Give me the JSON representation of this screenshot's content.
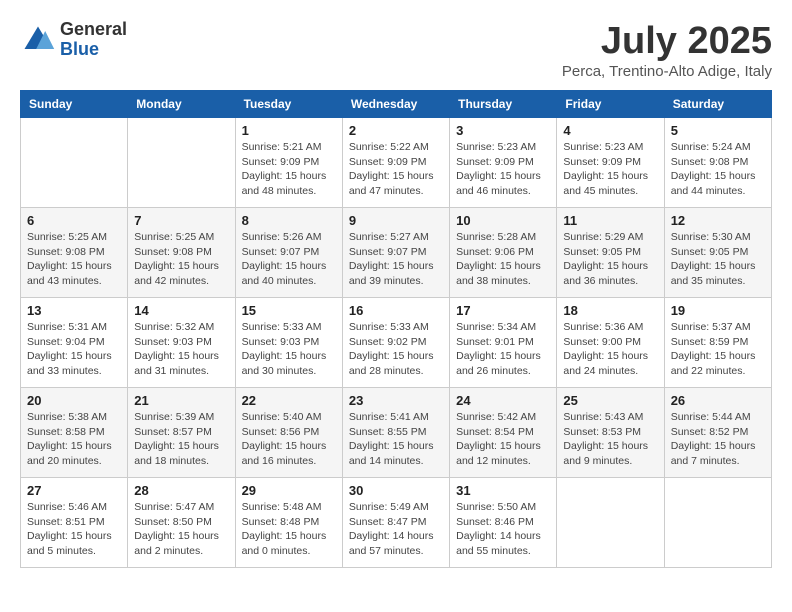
{
  "header": {
    "logo_line1": "General",
    "logo_line2": "Blue",
    "month": "July 2025",
    "location": "Perca, Trentino-Alto Adige, Italy"
  },
  "weekdays": [
    "Sunday",
    "Monday",
    "Tuesday",
    "Wednesday",
    "Thursday",
    "Friday",
    "Saturday"
  ],
  "weeks": [
    [
      {
        "day": "",
        "info": ""
      },
      {
        "day": "",
        "info": ""
      },
      {
        "day": "1",
        "info": "Sunrise: 5:21 AM\nSunset: 9:09 PM\nDaylight: 15 hours\nand 48 minutes."
      },
      {
        "day": "2",
        "info": "Sunrise: 5:22 AM\nSunset: 9:09 PM\nDaylight: 15 hours\nand 47 minutes."
      },
      {
        "day": "3",
        "info": "Sunrise: 5:23 AM\nSunset: 9:09 PM\nDaylight: 15 hours\nand 46 minutes."
      },
      {
        "day": "4",
        "info": "Sunrise: 5:23 AM\nSunset: 9:09 PM\nDaylight: 15 hours\nand 45 minutes."
      },
      {
        "day": "5",
        "info": "Sunrise: 5:24 AM\nSunset: 9:08 PM\nDaylight: 15 hours\nand 44 minutes."
      }
    ],
    [
      {
        "day": "6",
        "info": "Sunrise: 5:25 AM\nSunset: 9:08 PM\nDaylight: 15 hours\nand 43 minutes."
      },
      {
        "day": "7",
        "info": "Sunrise: 5:25 AM\nSunset: 9:08 PM\nDaylight: 15 hours\nand 42 minutes."
      },
      {
        "day": "8",
        "info": "Sunrise: 5:26 AM\nSunset: 9:07 PM\nDaylight: 15 hours\nand 40 minutes."
      },
      {
        "day": "9",
        "info": "Sunrise: 5:27 AM\nSunset: 9:07 PM\nDaylight: 15 hours\nand 39 minutes."
      },
      {
        "day": "10",
        "info": "Sunrise: 5:28 AM\nSunset: 9:06 PM\nDaylight: 15 hours\nand 38 minutes."
      },
      {
        "day": "11",
        "info": "Sunrise: 5:29 AM\nSunset: 9:05 PM\nDaylight: 15 hours\nand 36 minutes."
      },
      {
        "day": "12",
        "info": "Sunrise: 5:30 AM\nSunset: 9:05 PM\nDaylight: 15 hours\nand 35 minutes."
      }
    ],
    [
      {
        "day": "13",
        "info": "Sunrise: 5:31 AM\nSunset: 9:04 PM\nDaylight: 15 hours\nand 33 minutes."
      },
      {
        "day": "14",
        "info": "Sunrise: 5:32 AM\nSunset: 9:03 PM\nDaylight: 15 hours\nand 31 minutes."
      },
      {
        "day": "15",
        "info": "Sunrise: 5:33 AM\nSunset: 9:03 PM\nDaylight: 15 hours\nand 30 minutes."
      },
      {
        "day": "16",
        "info": "Sunrise: 5:33 AM\nSunset: 9:02 PM\nDaylight: 15 hours\nand 28 minutes."
      },
      {
        "day": "17",
        "info": "Sunrise: 5:34 AM\nSunset: 9:01 PM\nDaylight: 15 hours\nand 26 minutes."
      },
      {
        "day": "18",
        "info": "Sunrise: 5:36 AM\nSunset: 9:00 PM\nDaylight: 15 hours\nand 24 minutes."
      },
      {
        "day": "19",
        "info": "Sunrise: 5:37 AM\nSunset: 8:59 PM\nDaylight: 15 hours\nand 22 minutes."
      }
    ],
    [
      {
        "day": "20",
        "info": "Sunrise: 5:38 AM\nSunset: 8:58 PM\nDaylight: 15 hours\nand 20 minutes."
      },
      {
        "day": "21",
        "info": "Sunrise: 5:39 AM\nSunset: 8:57 PM\nDaylight: 15 hours\nand 18 minutes."
      },
      {
        "day": "22",
        "info": "Sunrise: 5:40 AM\nSunset: 8:56 PM\nDaylight: 15 hours\nand 16 minutes."
      },
      {
        "day": "23",
        "info": "Sunrise: 5:41 AM\nSunset: 8:55 PM\nDaylight: 15 hours\nand 14 minutes."
      },
      {
        "day": "24",
        "info": "Sunrise: 5:42 AM\nSunset: 8:54 PM\nDaylight: 15 hours\nand 12 minutes."
      },
      {
        "day": "25",
        "info": "Sunrise: 5:43 AM\nSunset: 8:53 PM\nDaylight: 15 hours\nand 9 minutes."
      },
      {
        "day": "26",
        "info": "Sunrise: 5:44 AM\nSunset: 8:52 PM\nDaylight: 15 hours\nand 7 minutes."
      }
    ],
    [
      {
        "day": "27",
        "info": "Sunrise: 5:46 AM\nSunset: 8:51 PM\nDaylight: 15 hours\nand 5 minutes."
      },
      {
        "day": "28",
        "info": "Sunrise: 5:47 AM\nSunset: 8:50 PM\nDaylight: 15 hours\nand 2 minutes."
      },
      {
        "day": "29",
        "info": "Sunrise: 5:48 AM\nSunset: 8:48 PM\nDaylight: 15 hours\nand 0 minutes."
      },
      {
        "day": "30",
        "info": "Sunrise: 5:49 AM\nSunset: 8:47 PM\nDaylight: 14 hours\nand 57 minutes."
      },
      {
        "day": "31",
        "info": "Sunrise: 5:50 AM\nSunset: 8:46 PM\nDaylight: 14 hours\nand 55 minutes."
      },
      {
        "day": "",
        "info": ""
      },
      {
        "day": "",
        "info": ""
      }
    ]
  ]
}
